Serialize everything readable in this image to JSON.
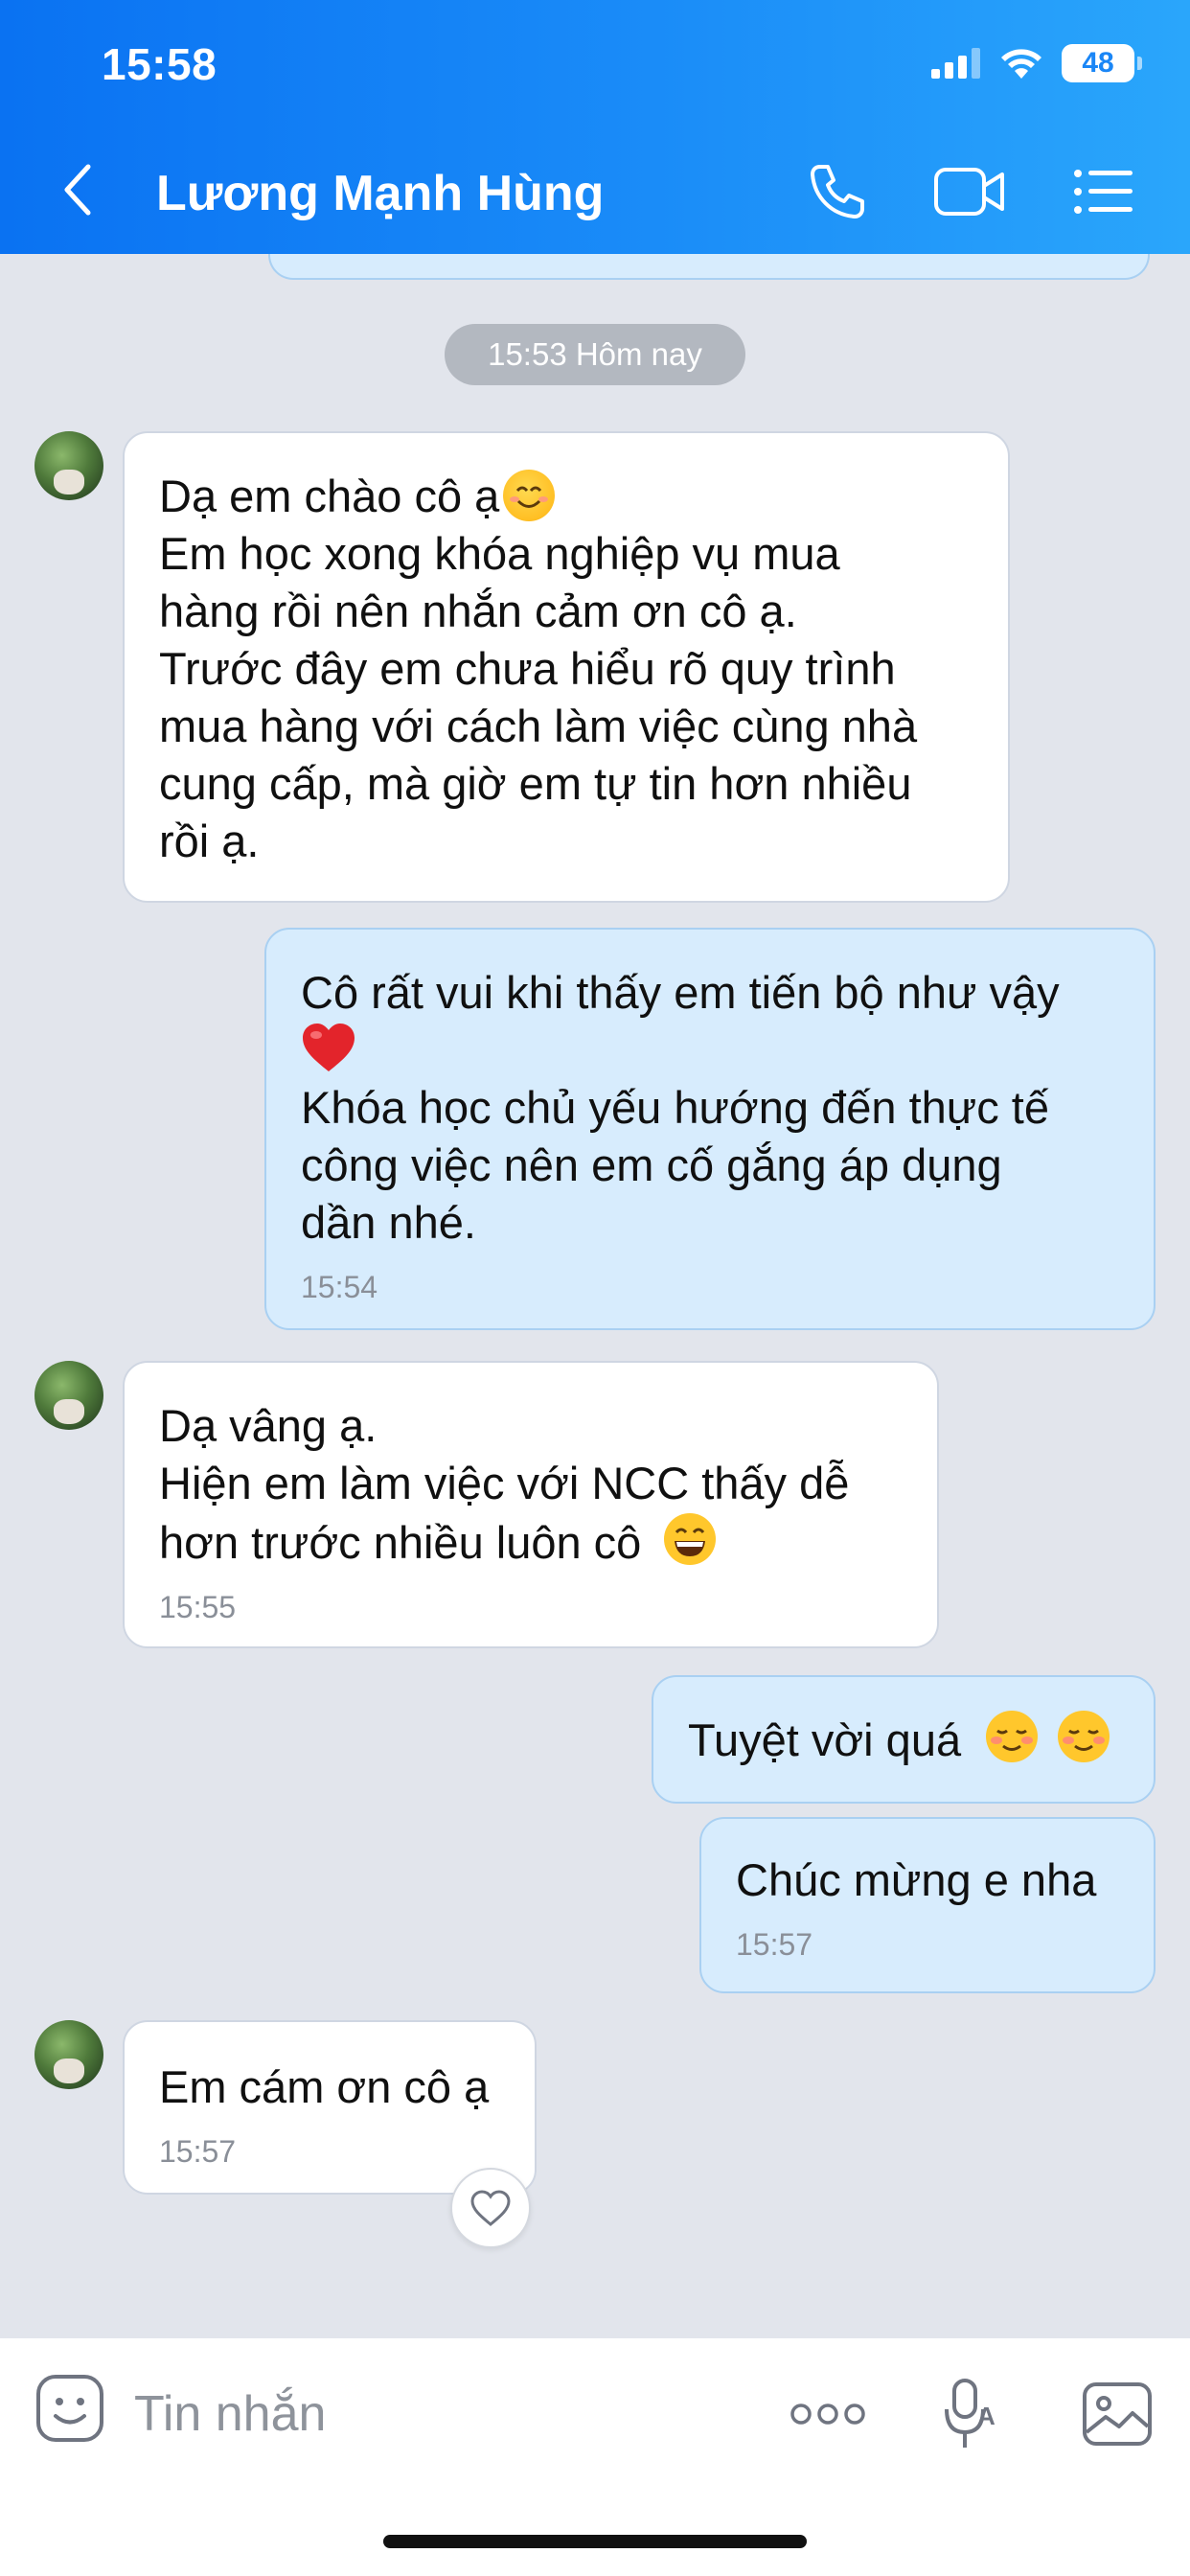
{
  "status_bar": {
    "time": "15:58",
    "battery": "48"
  },
  "header": {
    "contact_name": "Lương Mạnh Hùng"
  },
  "date_separator": "15:53 Hôm nay",
  "messages": [
    {
      "direction": "in",
      "lines": [
        "Dạ em chào cô ạ",
        "Em học xong khóa nghiệp vụ mua",
        "hàng rồi nên nhắn cảm ơn cô ạ.",
        "Trước đây em chưa hiểu rõ quy trình",
        "mua hàng với cách làm việc cùng nhà",
        "cung cấp, mà giờ em tự tin hơn nhiều",
        "rồi ạ."
      ],
      "emoji_after_line_0": "smiling-face-icon",
      "time": ""
    },
    {
      "direction": "out",
      "lines": [
        "Cô rất vui khi thấy em tiến bộ như vậy",
        "",
        "Khóa học chủ yếu hướng đến thực tế",
        "công việc nên em cố gắng áp dụng",
        "dần nhé."
      ],
      "emoji_line_1": "red-heart-icon",
      "time": "15:54"
    },
    {
      "direction": "in",
      "lines": [
        "Dạ vâng ạ.",
        "Hiện em làm việc với NCC thấy dễ",
        "hơn trước nhiều luôn cô"
      ],
      "emoji_after_line_2": "grinning-face-icon",
      "time": "15:55"
    },
    {
      "direction": "out",
      "lines": [
        "Tuyệt vời quá"
      ],
      "emoji_after_line_0": "smiling-blush-face-icon x2",
      "time": ""
    },
    {
      "direction": "out",
      "lines": [
        "Chúc mừng e nha"
      ],
      "time": "15:57"
    },
    {
      "direction": "in",
      "lines": [
        "Em cám ơn cô ạ"
      ],
      "time": "15:57",
      "reaction": "heart-outline-icon"
    }
  ],
  "input_bar": {
    "placeholder": "Tin nhắn"
  },
  "colors": {
    "header_gradient_start": "#0a72f2",
    "header_gradient_end": "#2aa6fb",
    "outgoing_bubble": "#d7ecfd",
    "incoming_bubble": "#ffffff",
    "chat_background": "#e2e5ec"
  }
}
